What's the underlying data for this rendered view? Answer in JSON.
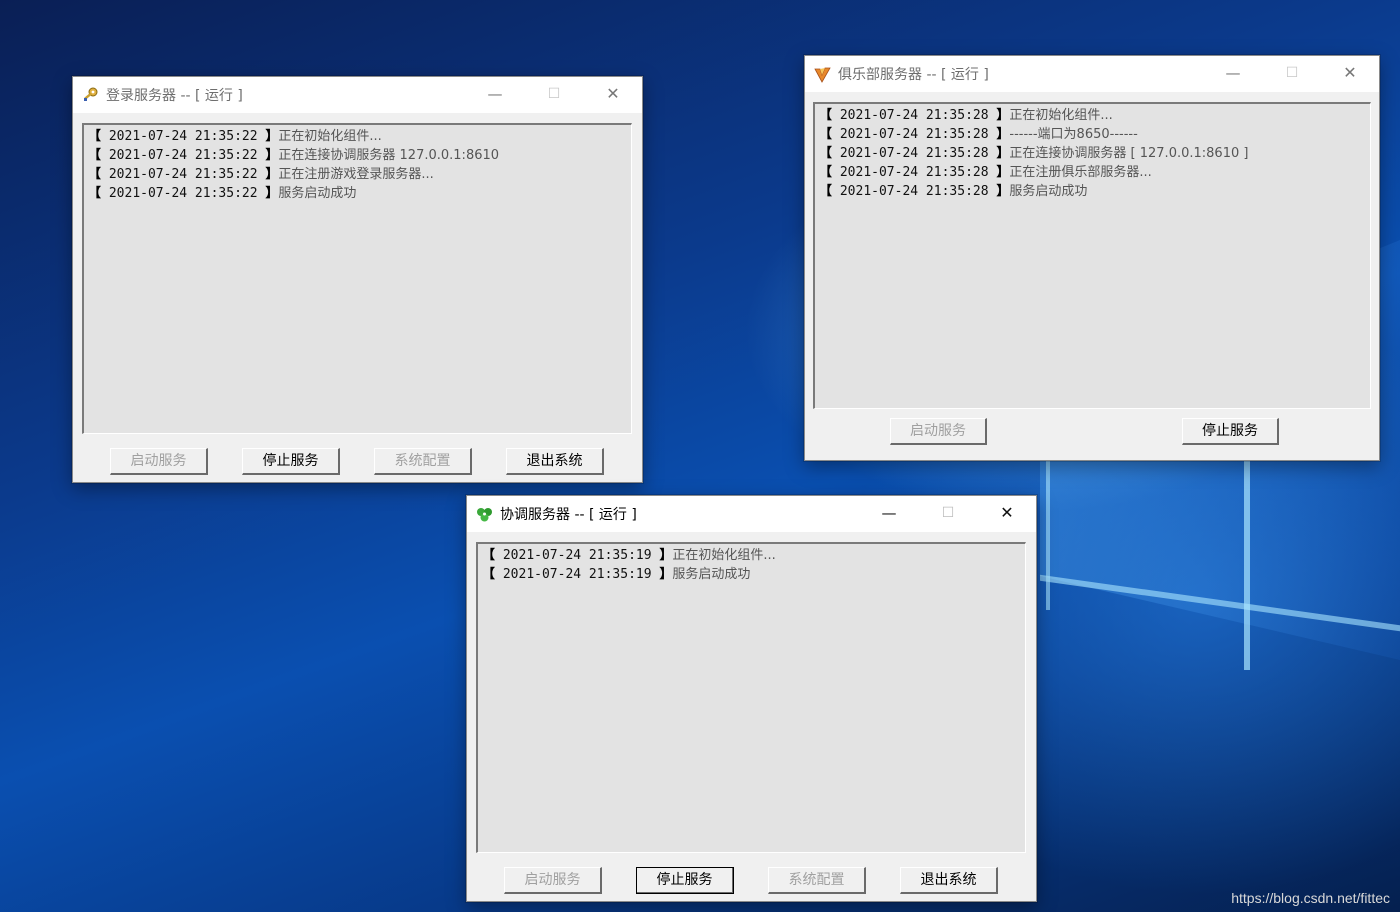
{
  "colors": {
    "title_inactive": "#6e6e6e",
    "log_bg": "#e3e3e3",
    "window_bg": "#f0f0f0"
  },
  "windows": {
    "login": {
      "title": "登录服务器 -- [ 运行 ]",
      "icon": "key-icon",
      "min": "—",
      "max": "☐",
      "close": "✕",
      "log": [
        {
          "open": "【",
          "ts": "2021-07-24 21:35:22",
          "close": "】",
          "msg": "正在初始化组件..."
        },
        {
          "open": "【",
          "ts": "2021-07-24 21:35:22",
          "close": "】",
          "msg": "正在连接协调服务器 127.0.0.1:8610"
        },
        {
          "open": "【",
          "ts": "2021-07-24 21:35:22",
          "close": "】",
          "msg": "正在注册游戏登录服务器..."
        },
        {
          "open": "【",
          "ts": "2021-07-24 21:35:22",
          "close": "】",
          "msg": "服务启动成功"
        }
      ],
      "buttons": {
        "start": "启动服务",
        "stop": "停止服务",
        "config": "系统配置",
        "exit": "退出系统"
      }
    },
    "club": {
      "title": "俱乐部服务器 -- [ 运行 ]",
      "icon": "club-icon",
      "min": "—",
      "max": "☐",
      "close": "✕",
      "log": [
        {
          "open": "【",
          "ts": "2021-07-24 21:35:28",
          "close": "】",
          "msg": "正在初始化组件..."
        },
        {
          "open": "【",
          "ts": "2021-07-24 21:35:28",
          "close": "】",
          "msg": "------端口为8650------"
        },
        {
          "open": "【",
          "ts": "2021-07-24 21:35:28",
          "close": "】",
          "msg": "正在连接协调服务器 [ 127.0.0.1:8610 ]"
        },
        {
          "open": "【",
          "ts": "2021-07-24 21:35:28",
          "close": "】",
          "msg": "正在注册俱乐部服务器..."
        },
        {
          "open": "【",
          "ts": "2021-07-24 21:35:28",
          "close": "】",
          "msg": "服务启动成功"
        }
      ],
      "buttons": {
        "start": "启动服务",
        "stop": "停止服务"
      }
    },
    "coord": {
      "title": "协调服务器 -- [ 运行 ]",
      "icon": "clover-icon",
      "min": "—",
      "max": "☐",
      "close": "✕",
      "log": [
        {
          "open": "【",
          "ts": "2021-07-24 21:35:19",
          "close": "】",
          "msg": "正在初始化组件..."
        },
        {
          "open": "【",
          "ts": "2021-07-24 21:35:19",
          "close": "】",
          "msg": "服务启动成功"
        }
      ],
      "buttons": {
        "start": "启动服务",
        "stop": "停止服务",
        "config": "系统配置",
        "exit": "退出系统"
      }
    }
  },
  "watermark": "https://blog.csdn.net/fittec"
}
